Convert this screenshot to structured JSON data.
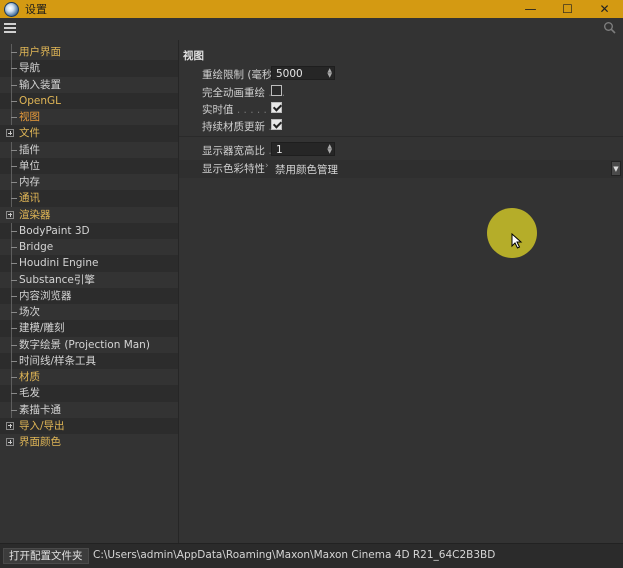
{
  "window": {
    "title": "设置",
    "controls": {
      "minimize": "—",
      "maximize": "☐",
      "close": "✕"
    }
  },
  "sidebar": {
    "items": [
      {
        "label": "用户界面",
        "type": "leaf",
        "style": "highlight"
      },
      {
        "label": "导航",
        "type": "leaf",
        "style": "normal"
      },
      {
        "label": "输入装置",
        "type": "leaf",
        "style": "normal"
      },
      {
        "label": "OpenGL",
        "type": "leaf",
        "style": "highlight"
      },
      {
        "label": "视图",
        "type": "leaf",
        "style": "selected"
      },
      {
        "label": "文件",
        "type": "expandable",
        "style": "highlight"
      },
      {
        "label": "插件",
        "type": "leaf",
        "style": "normal"
      },
      {
        "label": "单位",
        "type": "leaf",
        "style": "normal"
      },
      {
        "label": "内存",
        "type": "leaf",
        "style": "normal"
      },
      {
        "label": "通讯",
        "type": "leaf",
        "style": "highlight"
      },
      {
        "label": "渲染器",
        "type": "expandable",
        "style": "highlight"
      },
      {
        "label": "BodyPaint 3D",
        "type": "leaf",
        "style": "normal"
      },
      {
        "label": "Bridge",
        "type": "leaf",
        "style": "normal"
      },
      {
        "label": "Houdini Engine",
        "type": "leaf",
        "style": "normal"
      },
      {
        "label": "Substance引擎",
        "type": "leaf",
        "style": "normal"
      },
      {
        "label": "内容浏览器",
        "type": "leaf",
        "style": "normal"
      },
      {
        "label": "场次",
        "type": "leaf",
        "style": "normal"
      },
      {
        "label": "建模/雕刻",
        "type": "leaf",
        "style": "normal"
      },
      {
        "label": "数字绘景 (Projection Man)",
        "type": "leaf",
        "style": "normal"
      },
      {
        "label": "时间线/样条工具",
        "type": "leaf",
        "style": "normal"
      },
      {
        "label": "材质",
        "type": "leaf",
        "style": "highlight"
      },
      {
        "label": "毛发",
        "type": "leaf",
        "style": "normal"
      },
      {
        "label": "素描卡通",
        "type": "leaf",
        "style": "normal"
      },
      {
        "label": "导入/导出",
        "type": "expandable",
        "style": "highlight"
      },
      {
        "label": "界面颜色",
        "type": "expandable",
        "style": "highlight"
      }
    ]
  },
  "main": {
    "section_title": "视图",
    "settings": [
      {
        "label": "重绘限制 (毫秒)",
        "control": "number",
        "value": "5000"
      },
      {
        "label": "完全动画重绘",
        "dots": " . . .",
        "control": "checkbox",
        "checked": false
      },
      {
        "label": "实时值",
        "dots": " . . . . . . .",
        "control": "checkbox",
        "checked": true
      },
      {
        "label": "持续材质更新",
        "dots": " . .",
        "control": "checkbox",
        "checked": true
      }
    ],
    "aspect": {
      "label": "显示器宽高比",
      "dots": " . . .",
      "value": "1"
    },
    "color_profile": {
      "label": "显示色彩特性",
      "dots": " ",
      "value": "禁用颜色管理"
    }
  },
  "footer": {
    "open_folder_label": "打开配置文件夹",
    "path": "C:\\Users\\admin\\AppData\\Roaming\\Maxon\\Maxon Cinema 4D R21_64C2B3BD"
  },
  "colors": {
    "titlebar": "#d49a12",
    "selected": "#e89a3a",
    "highlight": "#e0b656",
    "cursor_halo": "#cdc328"
  }
}
